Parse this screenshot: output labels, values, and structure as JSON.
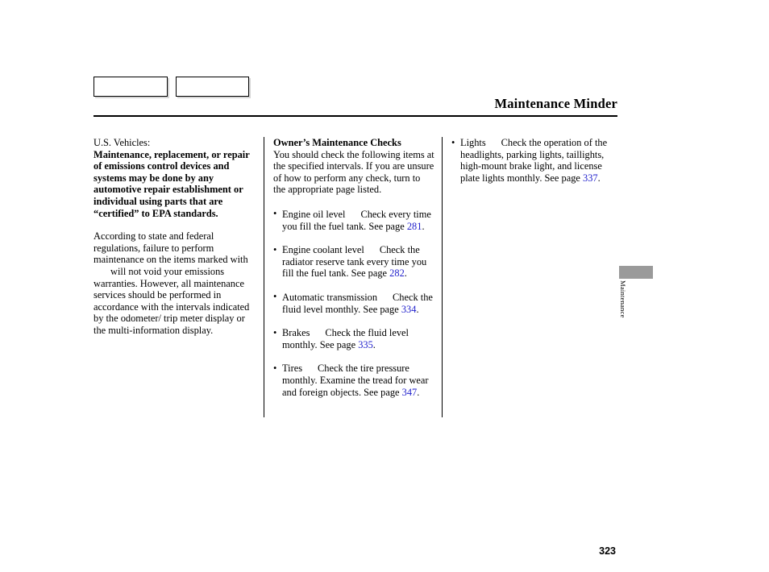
{
  "header": {
    "title": "Maintenance Minder"
  },
  "tabs": [
    {
      "label": ""
    },
    {
      "label": ""
    }
  ],
  "left_column": {
    "lead": "U.S. Vehicles:",
    "bold_statement": "Maintenance, replacement, or repair of emissions control devices and systems may be done by any automotive repair establishment or individual using parts that are “certified” to EPA standards.",
    "paragraph_part1": "According to state and federal regulations, failure to perform maintenance on the items marked with",
    "paragraph_part2": "will not void your emissions warranties. However, all maintenance services should be performed in accordance with the intervals indicated by the odometer/ trip meter display or the multi-information display."
  },
  "middle_column": {
    "heading": "Owner’s Maintenance Checks",
    "intro": "You should check the following items at the specified intervals. If you are unsure of how to perform any check, turn to the appropriate page listed.",
    "checks": [
      {
        "name": "Engine oil level",
        "text_before_page": "Check every time you fill the fuel tank. See page",
        "page": "281",
        "text_after_page": "."
      },
      {
        "name": "Engine coolant level",
        "text_before_page": "Check the radiator reserve tank every time you fill the fuel tank. See page",
        "page": "282",
        "text_after_page": "."
      },
      {
        "name": "Automatic transmission",
        "text_before_page": "Check the fluid level monthly. See page",
        "page": "334",
        "text_after_page": "."
      },
      {
        "name": "Brakes",
        "text_before_page": "Check the fluid level monthly. See page",
        "page": "335",
        "text_after_page": "."
      },
      {
        "name": "Tires",
        "text_before_page": "Check the tire pressure monthly. Examine the tread for wear and foreign objects. See page",
        "page": "347",
        "text_after_page": "."
      }
    ]
  },
  "right_column": {
    "checks": [
      {
        "name": "Lights",
        "text_before_page": "Check the operation of the headlights, parking lights, taillights, high-mount brake light, and license plate lights monthly. See page",
        "page": "337",
        "text_after_page": "."
      }
    ]
  },
  "edge_index": {
    "label": "Maintenance",
    "tab_color": "#9a9a9a"
  },
  "footer": {
    "page_number": "323"
  },
  "colors": {
    "link_blue": "#2222cc",
    "text": "#000000"
  },
  "bullet_glyph": "•"
}
